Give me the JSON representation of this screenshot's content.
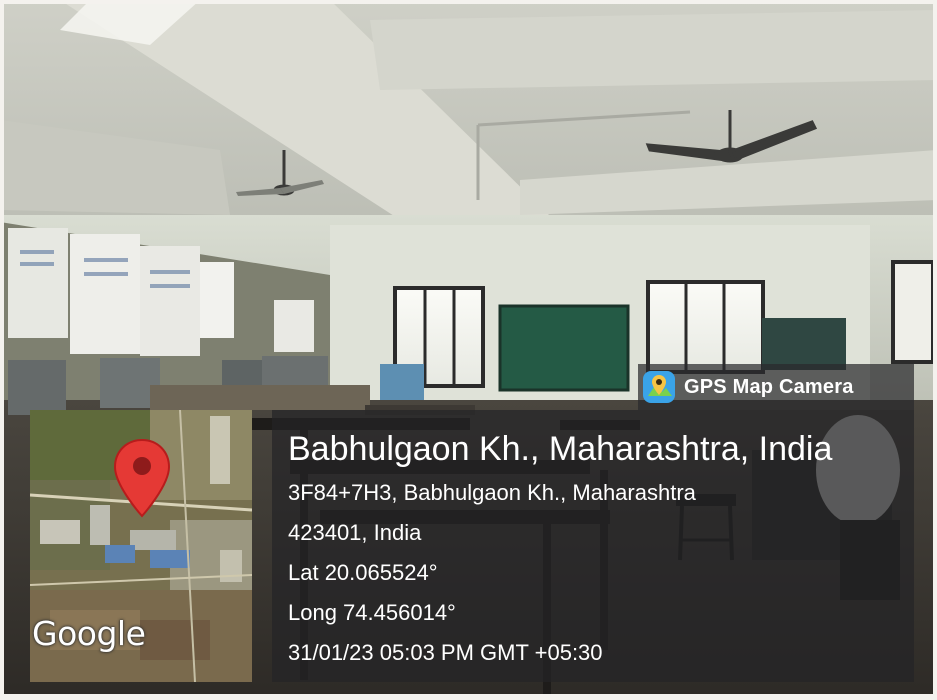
{
  "app": {
    "name": "GPS Map Camera",
    "icon": "map-pin-camera-icon"
  },
  "map": {
    "attribution": "Google",
    "marker_icon": "location-pin-icon",
    "marker_color": "#e53935"
  },
  "location": {
    "title": "Babhulgaon Kh., Maharashtra, India",
    "address_line1": "3F84+7H3, Babhulgaon Kh., Maharashtra",
    "address_line2": "423401, India",
    "latitude": "Lat 20.065524°",
    "longitude": "Long 74.456014°",
    "datetime": "31/01/23 05:03 PM GMT +05:30"
  }
}
